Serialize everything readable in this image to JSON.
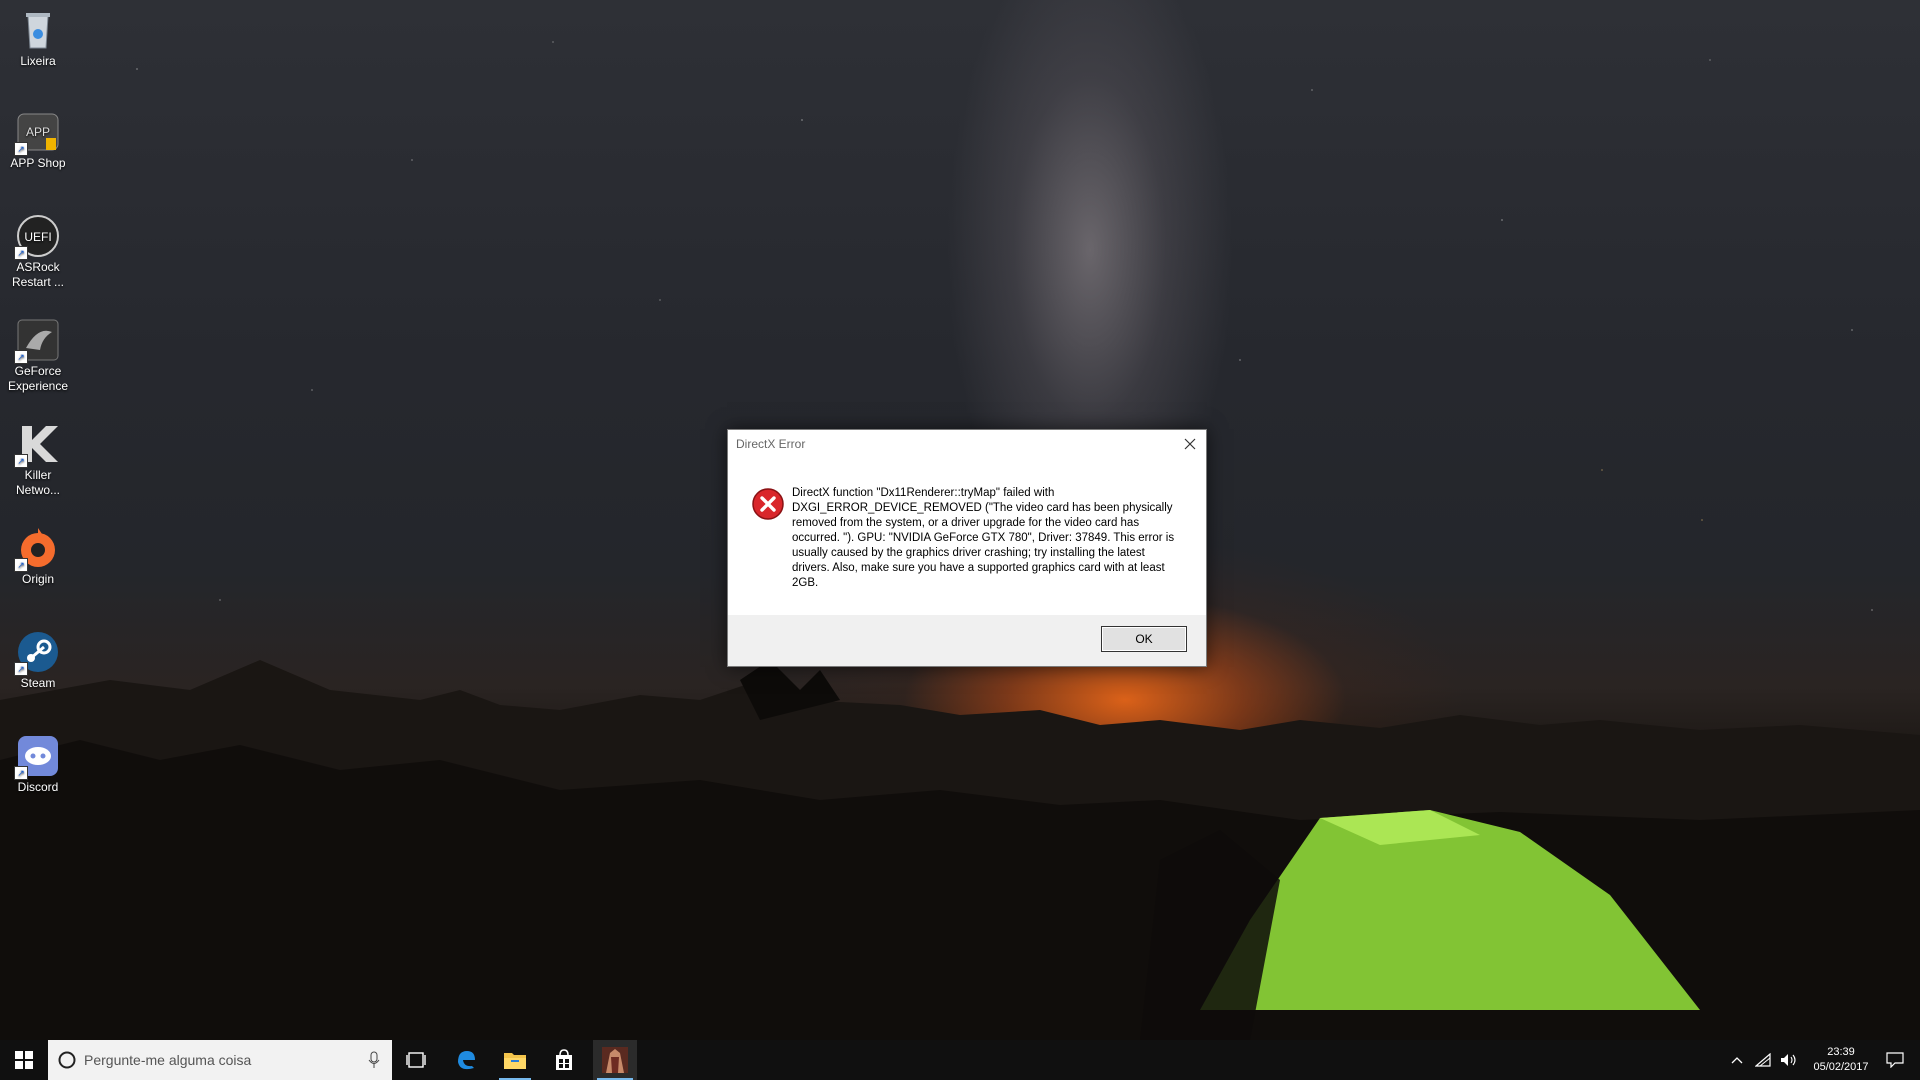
{
  "desktop": {
    "icons": [
      {
        "label": "Lixeira",
        "icon": "recycle-bin-icon"
      },
      {
        "label": "APP Shop",
        "icon": "app-shop-icon"
      },
      {
        "label": "ASRock Restart ...",
        "icon": "asrock-uefi-icon"
      },
      {
        "label": "GeForce Experience",
        "icon": "geforce-experience-icon"
      },
      {
        "label": "Killer Netwo...",
        "icon": "killer-network-icon"
      },
      {
        "label": "Origin",
        "icon": "origin-icon"
      },
      {
        "label": "Steam",
        "icon": "steam-icon"
      },
      {
        "label": "Discord",
        "icon": "discord-icon"
      }
    ]
  },
  "dialog": {
    "title": "DirectX Error",
    "message": "DirectX function \"Dx11Renderer::tryMap\" failed with DXGI_ERROR_DEVICE_REMOVED (\"The video card has been physically removed from the system, or a driver upgrade for the video card has occurred. \"). GPU: \"NVIDIA GeForce GTX 780\", Driver: 37849. This error is usually caused by the graphics driver crashing; try installing the latest drivers. Also, make sure you have a supported graphics card with at least 2GB.",
    "ok_label": "OK",
    "icon": "error-icon",
    "error_color": "#d9262b"
  },
  "taskbar": {
    "search_placeholder": "Pergunte-me alguma coisa",
    "pinned": [
      "start-icon",
      "task-view-icon",
      "edge-icon",
      "file-explorer-icon",
      "store-icon",
      "game-app-icon"
    ],
    "clock": {
      "time": "23:39",
      "date": "05/02/2017"
    },
    "accent_color": "#76b9ed"
  }
}
